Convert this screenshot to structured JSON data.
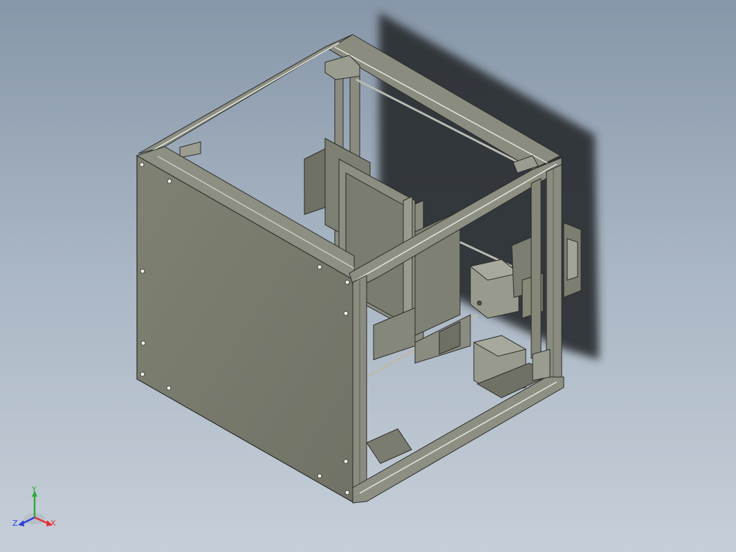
{
  "viewport": {
    "model": "3d-printer-frame-assembly",
    "background_top": "#8797a9",
    "background_bottom": "#c6cfd9"
  },
  "colors": {
    "sheet_metal": "#787a6c",
    "extrusion": "#8a8c80",
    "extrusion_dark": "#4f5148",
    "shadow": "#2b2e33",
    "rod": "#b9bbb2",
    "edge": "#2a2b27"
  },
  "triad": {
    "x_label": "X",
    "y_label": "Y",
    "z_label": "Z",
    "x_color": "#e03030",
    "y_color": "#2faa38",
    "z_color": "#2a43d6"
  }
}
